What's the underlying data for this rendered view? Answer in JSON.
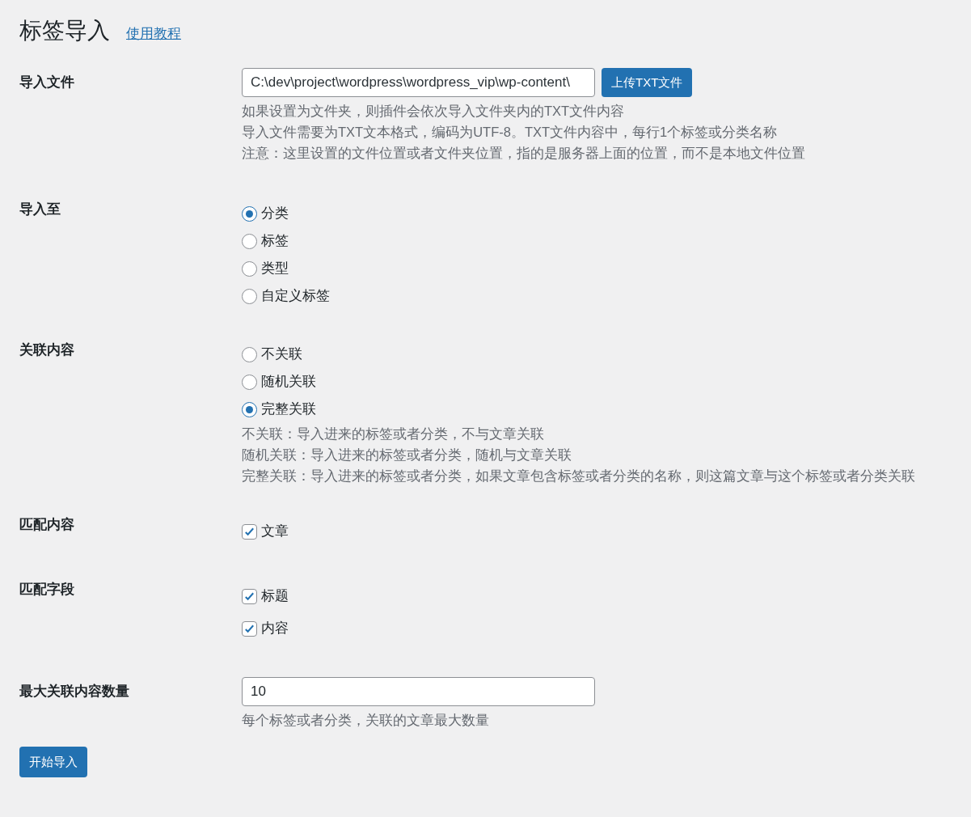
{
  "page": {
    "title": "标签导入",
    "tutorial_link": "使用教程"
  },
  "sections": [
    {
      "kind": "file",
      "label": "导入文件",
      "value": "C:\\dev\\project\\wordpress\\wordpress_vip\\wp-content\\",
      "button": "上传TXT文件",
      "descriptions": [
        "如果设置为文件夹，则插件会依次导入文件夹内的TXT文件内容",
        "导入文件需要为TXT文本格式，编码为UTF-8。TXT文件内容中，每行1个标签或分类名称",
        "注意：这里设置的文件位置或者文件夹位置，指的是服务器上面的位置，而不是本地文件位置"
      ]
    },
    {
      "kind": "radio",
      "label": "导入至",
      "options": [
        {
          "label": "分类",
          "selected": true
        },
        {
          "label": "标签",
          "selected": false
        },
        {
          "label": "类型",
          "selected": false
        },
        {
          "label": "自定义标签",
          "selected": false
        }
      ]
    },
    {
      "kind": "radio",
      "label": "关联内容",
      "options": [
        {
          "label": "不关联",
          "selected": false
        },
        {
          "label": "随机关联",
          "selected": false
        },
        {
          "label": "完整关联",
          "selected": true
        }
      ],
      "descriptions": [
        "不关联：导入进来的标签或者分类，不与文章关联",
        "随机关联：导入进来的标签或者分类，随机与文章关联",
        "完整关联：导入进来的标签或者分类，如果文章包含标签或者分类的名称，则这篇文章与这个标签或者分类关联"
      ]
    },
    {
      "kind": "checkbox",
      "label": "匹配内容",
      "options": [
        {
          "label": "文章",
          "checked": true
        }
      ]
    },
    {
      "kind": "checkbox",
      "label": "匹配字段",
      "options": [
        {
          "label": "标题",
          "checked": true
        },
        {
          "label": "内容",
          "checked": true
        }
      ]
    },
    {
      "kind": "number",
      "label": "最大关联内容数量",
      "value": "10",
      "descriptions": [
        "每个标签或者分类，关联的文章最大数量"
      ]
    }
  ],
  "submit": "开始导入"
}
